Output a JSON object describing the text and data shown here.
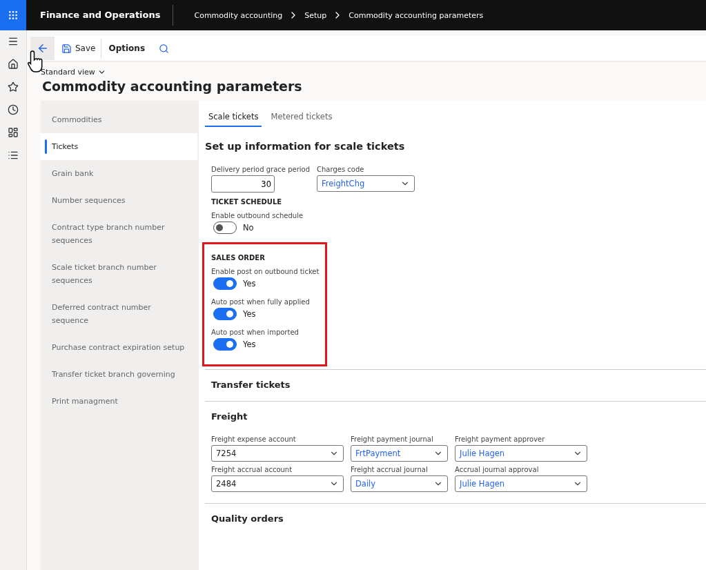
{
  "app": {
    "title": "Finance and Operations"
  },
  "breadcrumb": [
    "Commodity accounting",
    "Setup",
    "Commodity accounting parameters"
  ],
  "toolbar": {
    "save": "Save",
    "options": "Options"
  },
  "view": "Standard view",
  "page_title": "Commodity accounting parameters",
  "nav": [
    {
      "label": "Commodities",
      "selected": false
    },
    {
      "label": "Tickets",
      "selected": true
    },
    {
      "label": "Grain bank",
      "selected": false
    },
    {
      "label": "Number sequences",
      "selected": false
    },
    {
      "label": "Contract type branch number sequences",
      "selected": false
    },
    {
      "label": "Scale ticket branch number sequences",
      "selected": false
    },
    {
      "label": "Deferred contract number sequence",
      "selected": false
    },
    {
      "label": "Purchase contract expiration setup",
      "selected": false
    },
    {
      "label": "Transfer ticket branch governing",
      "selected": false
    },
    {
      "label": "Print managment",
      "selected": false
    }
  ],
  "tabs": [
    {
      "label": "Scale tickets",
      "selected": true
    },
    {
      "label": "Metered tickets",
      "selected": false
    }
  ],
  "section_title": "Set up information for scale tickets",
  "top_fields": [
    {
      "kind": "number",
      "label": "Delivery period grace period",
      "value": "30"
    },
    {
      "kind": "select",
      "label": "Charges code",
      "value": "FreightChg",
      "linked": true
    }
  ],
  "groups": [
    {
      "heading": "TICKET SCHEDULE",
      "highlighted": false,
      "toggles": [
        {
          "label": "Enable outbound schedule",
          "on": false,
          "state_text": "No"
        }
      ]
    },
    {
      "heading": "SALES ORDER",
      "highlighted": true,
      "toggles": [
        {
          "label": "Enable post on outbound ticket",
          "on": true,
          "state_text": "Yes"
        },
        {
          "label": "Auto post when fully applied",
          "on": true,
          "state_text": "Yes"
        },
        {
          "label": "Auto post when imported",
          "on": true,
          "state_text": "Yes"
        }
      ]
    }
  ],
  "fasttabs": [
    {
      "title": "Transfer tickets"
    },
    {
      "title": "Freight",
      "fields": [
        {
          "label": "Freight expense account",
          "value": "7254",
          "linked": false
        },
        {
          "label": "Freight payment journal",
          "value": "FrtPayment",
          "linked": true
        },
        {
          "label": "Freight payment approver",
          "value": "Julie Hagen",
          "linked": true
        },
        {
          "label": "Freight accrual account",
          "value": "2484",
          "linked": false
        },
        {
          "label": "Freight accrual journal",
          "value": "Daily",
          "linked": true
        },
        {
          "label": "Accrual journal approval",
          "value": "Julie Hagen",
          "linked": true
        }
      ]
    },
    {
      "title": "Quality orders"
    }
  ]
}
